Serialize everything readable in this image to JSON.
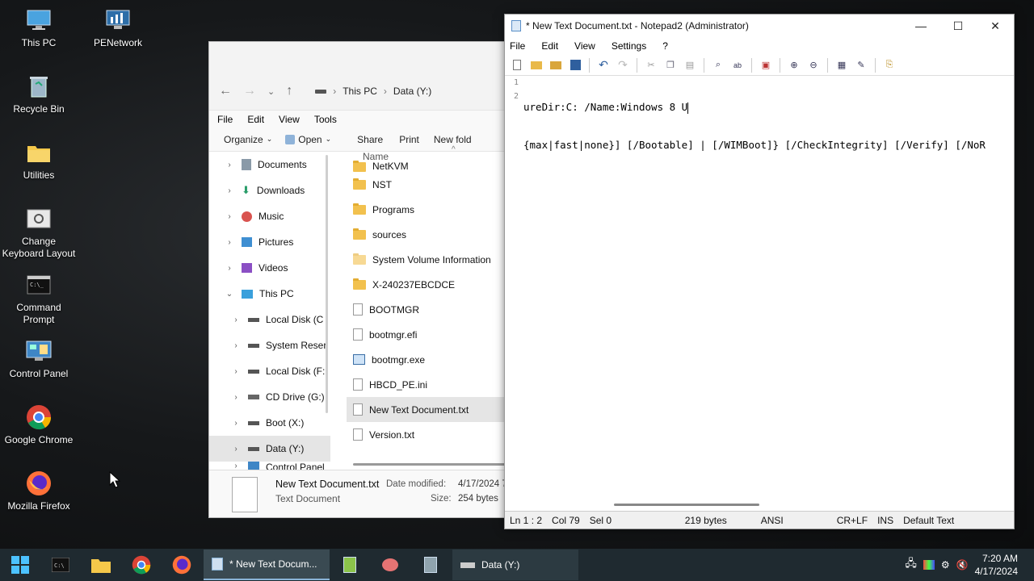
{
  "desktop": {
    "icons": [
      {
        "label": "This PC"
      },
      {
        "label": "PENetwork"
      },
      {
        "label": "Recycle Bin"
      },
      {
        "label": "Utilities"
      },
      {
        "label": "Change Keyboard Layout"
      },
      {
        "label": "Command Prompt"
      },
      {
        "label": "Control Panel"
      },
      {
        "label": "Google Chrome"
      },
      {
        "label": "Mozilla Firefox"
      }
    ]
  },
  "explorer": {
    "breadcrumb": [
      "This PC",
      "Data (Y:)"
    ],
    "menu": [
      "File",
      "Edit",
      "View",
      "Tools"
    ],
    "commands": {
      "organize": "Organize",
      "open": "Open",
      "share": "Share",
      "print": "Print",
      "new_folder": "New fold"
    },
    "nav_items": [
      "Documents",
      "Downloads",
      "Music",
      "Pictures",
      "Videos",
      "This PC",
      "Local Disk (C",
      "System Reser",
      "Local Disk (F:",
      "CD Drive (G:)",
      "Boot (X:)",
      "Data (Y:)",
      "Control Panel"
    ],
    "column_name": "Name",
    "files": [
      {
        "name": "NetKVM",
        "type": "folder"
      },
      {
        "name": "NST",
        "type": "folder"
      },
      {
        "name": "Programs",
        "type": "folder"
      },
      {
        "name": "sources",
        "type": "folder"
      },
      {
        "name": "System Volume Information",
        "type": "folder"
      },
      {
        "name": "X-240237EBCDCE",
        "type": "folder"
      },
      {
        "name": "BOOTMGR",
        "type": "file"
      },
      {
        "name": "bootmgr.efi",
        "type": "file"
      },
      {
        "name": "bootmgr.exe",
        "type": "exe"
      },
      {
        "name": "HBCD_PE.ini",
        "type": "file"
      },
      {
        "name": "New Text Document.txt",
        "type": "file"
      },
      {
        "name": "Version.txt",
        "type": "file"
      }
    ],
    "details": {
      "filename": "New Text Document.txt",
      "filetype": "Text Document",
      "date_label": "Date modified:",
      "date_value": "4/17/2024 7",
      "size_label": "Size:",
      "size_value": "254 bytes"
    }
  },
  "notepad": {
    "title": "* New Text Document.txt - Notepad2 (Administrator)",
    "menu": [
      "File",
      "Edit",
      "View",
      "Settings",
      "?"
    ],
    "line_numbers": [
      "1",
      "2"
    ],
    "lines": [
      "ureDir:C: /Name:Windows 8 U",
      "{max|fast|none}] [/Bootable] | [/WIMBoot]} [/CheckIntegrity] [/Verify] [/NoR"
    ],
    "status": {
      "position": "Ln 1 : 2",
      "col": "Col 79",
      "sel": "Sel 0",
      "bytes": "219 bytes",
      "encoding": "ANSI",
      "eol": "CR+LF",
      "mode": "INS",
      "scheme": "Default Text"
    }
  },
  "taskbar": {
    "tasks": [
      {
        "label": "* New Text Docum..."
      },
      {
        "label": "Data (Y:)"
      }
    ],
    "clock": {
      "time": "7:20 AM",
      "date": "4/17/2024"
    }
  },
  "colors": {
    "taskbar": "#1f2a30",
    "folder": "#f2c14e",
    "selection": "#e5e5e5"
  }
}
